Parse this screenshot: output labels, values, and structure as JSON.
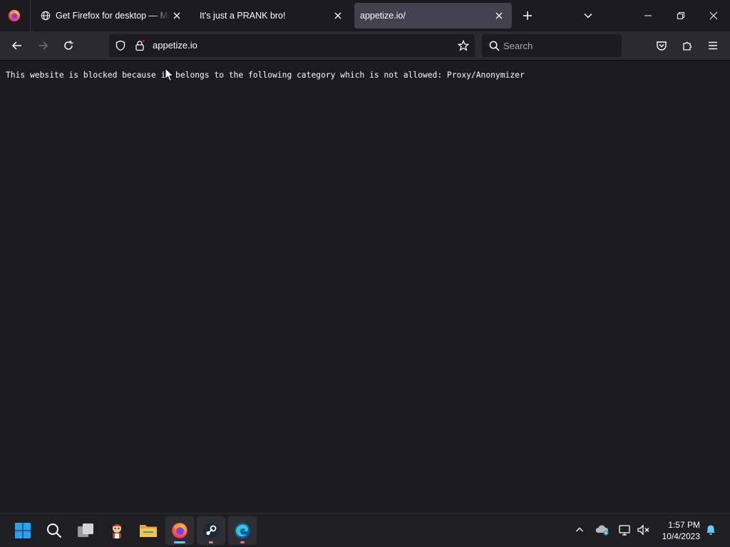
{
  "browser": {
    "tabs": [
      {
        "title": "Get Firefox for desktop — Mozilla",
        "icon": "globe-icon",
        "active": false
      },
      {
        "title": "It's just a PRANK bro!",
        "icon": "none",
        "active": false
      },
      {
        "title": "appetize.io/",
        "icon": "none",
        "active": true
      }
    ],
    "url": "appetize.io",
    "search_placeholder": "Search"
  },
  "page": {
    "message": "This website is blocked because it belongs to the following category which is not allowed: Proxy/Anonymizer"
  },
  "taskbar": {
    "apps": [
      "windows-start",
      "search",
      "task-view",
      "app-character",
      "file-explorer",
      "firefox",
      "steam",
      "edge"
    ],
    "clock_time": "1:57 PM",
    "clock_date": "10/4/2023"
  },
  "colors": {
    "tabstrip_bg": "#1c1b22",
    "navbar_bg": "#2b2a33",
    "active_tab_bg": "#42414d",
    "content_bg": "#1c1b22",
    "taskbar_bg": "#1f1f22",
    "accent_blue": "#60cdff"
  }
}
